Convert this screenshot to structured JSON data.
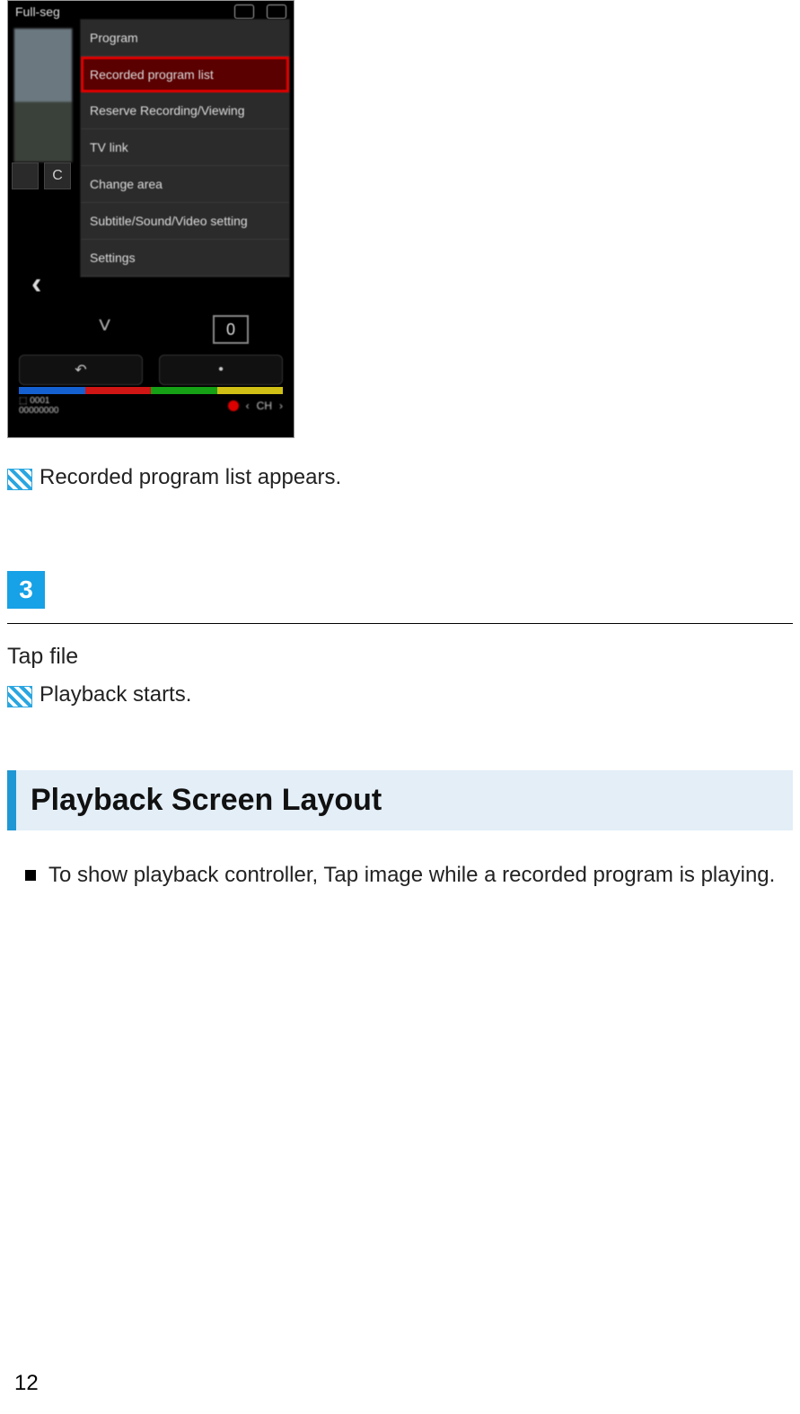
{
  "phone": {
    "top_label": "Full-seg",
    "menu": {
      "items": [
        "Program",
        "Recorded program list",
        "Reserve Recording/Viewing",
        "TV link",
        "Change area",
        "Subtitle/Sound/Video setting",
        "Settings"
      ],
      "highlight_index": 1
    },
    "zero": "0",
    "btn_back": "↶",
    "btn_dot": "•",
    "bottom_left": "⬚ 0001\n00000000",
    "bottom_ch": "CH"
  },
  "note1": "Recorded program list appears.",
  "step3": "3",
  "step3_title": "Tap file",
  "note2": "Playback starts.",
  "section_heading": "Playback Screen Layout",
  "bullet1": "To show playback controller, Tap image while a recorded program is playing.",
  "page_number": "12"
}
